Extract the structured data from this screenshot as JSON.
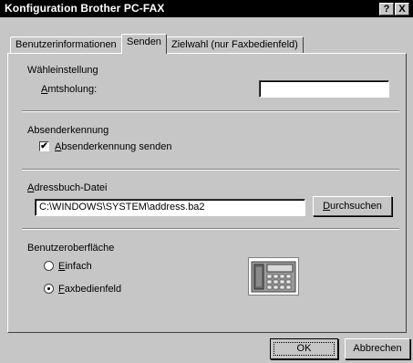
{
  "window": {
    "title": "Konfiguration Brother PC-FAX",
    "help_label": "?",
    "close_label": "X"
  },
  "tabs": [
    {
      "label": "Benutzerinformationen",
      "active": false
    },
    {
      "label": "Senden",
      "active": true
    },
    {
      "label": "Zielwahl (nur Faxbedienfeld)",
      "active": false
    }
  ],
  "dialing": {
    "group_label": "Wähleinstellung",
    "outside_line": {
      "label_u": "A",
      "label_rest": "mtsholung:",
      "value": ""
    }
  },
  "sender_id": {
    "group_label": "Absenderkennung",
    "send_checkbox": {
      "label_u": "A",
      "label_rest": "bsenderkennung senden",
      "checked": true,
      "mark": "✔"
    }
  },
  "address_book": {
    "group_label_u": "A",
    "group_label_rest": "dressbuch-Datei",
    "path_value": "C:\\WINDOWS\\SYSTEM\\address.ba2",
    "browse_u": "D",
    "browse_rest": "urchsuchen"
  },
  "ui": {
    "group_label": "Benutzeroberfläche",
    "options": [
      {
        "label_u": "E",
        "label_rest": "infach",
        "selected": false
      },
      {
        "label_u": "F",
        "label_rest": "axbedienfeld",
        "selected": true
      }
    ],
    "image_icon": "fax-machine-icon"
  },
  "footer": {
    "ok_label": "OK",
    "cancel_label": "Abbrechen"
  },
  "colors": {
    "face": "#c6c6c6",
    "titlebar": "#000000",
    "field": "#ffffff"
  }
}
